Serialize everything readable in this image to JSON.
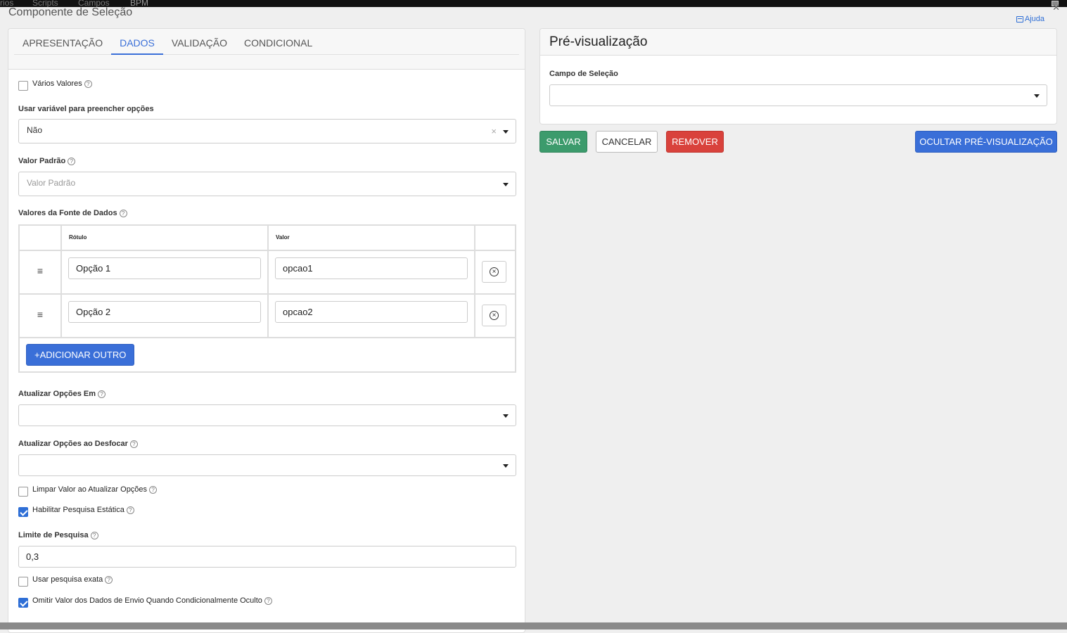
{
  "background_tabs": [
    "rios",
    "Scripts",
    "Campos",
    "BPM"
  ],
  "dialog": {
    "title": "Componente de Seleção",
    "help": "Ajuda"
  },
  "tabs": [
    "APRESENTAÇÃO",
    "DADOS",
    "VALIDAÇÃO",
    "CONDICIONAL"
  ],
  "active_tab": "DADOS",
  "form": {
    "multiple_values": {
      "label": "Vários Valores",
      "checked": false
    },
    "use_variable": {
      "label": "Usar variável para preencher opções",
      "value": "Não"
    },
    "default_value": {
      "label": "Valor Padrão",
      "placeholder": "Valor Padrão"
    },
    "data_source": {
      "label": "Valores da Fonte de Dados",
      "headers": {
        "label": "Rótulo",
        "value": "Valor"
      },
      "rows": [
        {
          "label": "Opção 1",
          "value": "opcao1"
        },
        {
          "label": "Opção 2",
          "value": "opcao2"
        }
      ],
      "add_button": "+ADICIONAR OUTRO",
      "drag_glyph": "≡",
      "remove_glyph": "×"
    },
    "refresh_on": {
      "label": "Atualizar Opções Em",
      "value": ""
    },
    "refresh_on_blur": {
      "label": "Atualizar Opções ao Desfocar",
      "value": ""
    },
    "clear_on_refresh": {
      "label": "Limpar Valor ao Atualizar Opções",
      "checked": false
    },
    "static_search": {
      "label": "Habilitar Pesquisa Estática",
      "checked": true
    },
    "search_threshold": {
      "label": "Limite de Pesquisa",
      "value": "0,3"
    },
    "exact_search": {
      "label": "Usar pesquisa exata",
      "checked": false
    },
    "omit_hidden": {
      "label": "Omitir Valor dos Dados de Envio Quando Condicionalmente Oculto",
      "checked": true
    }
  },
  "preview": {
    "title": "Pré-visualização",
    "field_label": "Campo de Seleção",
    "field_value": ""
  },
  "buttons": {
    "save": "SALVAR",
    "cancel": "CANCELAR",
    "remove": "REMOVER",
    "hide_preview": "OCULTAR PRÉ-VISUALIZAÇÃO"
  },
  "colors": {
    "primary": "#3a6fd8",
    "success": "#3c9b6c",
    "danger": "#d9423c"
  }
}
